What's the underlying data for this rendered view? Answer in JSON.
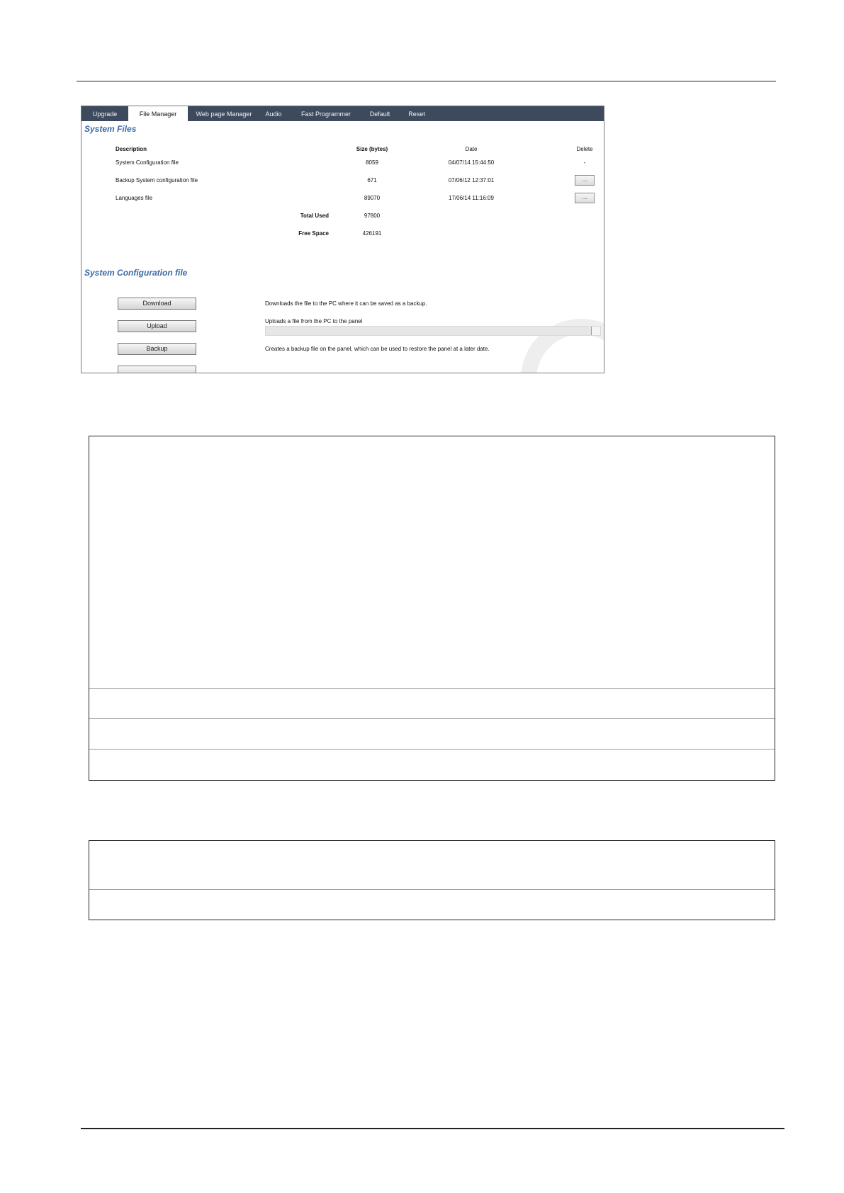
{
  "tabs": [
    {
      "label": "Upgrade"
    },
    {
      "label": "File Manager"
    },
    {
      "label": "Web page Manager"
    },
    {
      "label": "Audio"
    },
    {
      "label": "Fast Programmer"
    },
    {
      "label": "Default"
    },
    {
      "label": "Reset"
    }
  ],
  "system_files": {
    "title": "System Files",
    "columns": {
      "description": "Description",
      "size": "Size (bytes)",
      "date": "Date",
      "delete": "Delete"
    },
    "rows": [
      {
        "description": "System Configuration file",
        "size": "8059",
        "date": "04/07/14 15:44:50",
        "delete": "-"
      },
      {
        "description": "Backup System configuration file",
        "size": "671",
        "date": "07/06/12 12:37:01",
        "delete": "..."
      },
      {
        "description": "Languages file",
        "size": "89070",
        "date": "17/06/14 11:16:09",
        "delete": "..."
      }
    ],
    "total_used_label": "Total Used",
    "total_used_value": "97800",
    "free_space_label": "Free Space",
    "free_space_value": "426191"
  },
  "config_section": {
    "title": "System Configuration file",
    "actions": [
      {
        "label": "Download",
        "description": "Downloads the file to the PC where it can be saved as a backup."
      },
      {
        "label": "Upload",
        "description": "Uploads a file from the PC to the panel"
      },
      {
        "label": "Backup",
        "description": "Creates a backup file on the panel, which can be used to restore the panel at a later date."
      }
    ]
  },
  "colors": {
    "tab_bar": "#3d4a5e",
    "section_title": "#3b6aa8"
  }
}
